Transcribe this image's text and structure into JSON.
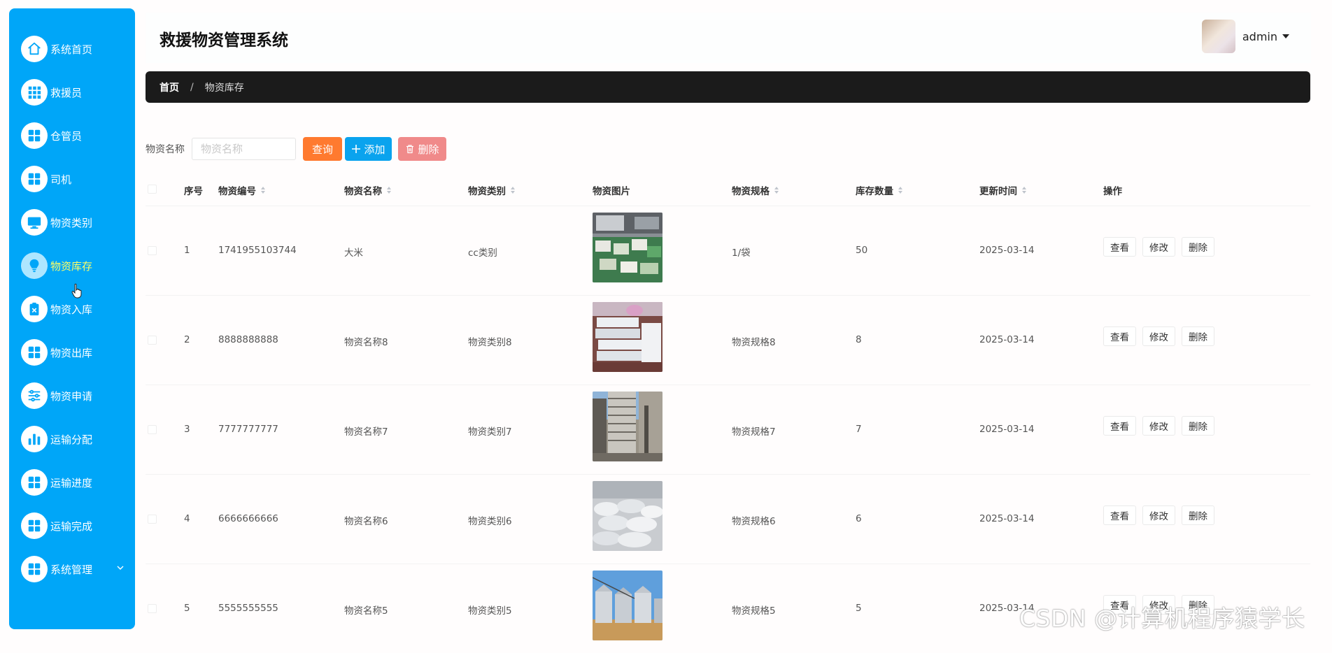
{
  "app": {
    "title": "救援物资管理系统"
  },
  "user": {
    "name": "admin"
  },
  "sidebar": {
    "items": [
      {
        "label": "系统首页",
        "icon": "home-icon"
      },
      {
        "label": "救援员",
        "icon": "grid-icon"
      },
      {
        "label": "仓管员",
        "icon": "grid-icon"
      },
      {
        "label": "司机",
        "icon": "grid-icon"
      },
      {
        "label": "物资类别",
        "icon": "monitor-icon"
      },
      {
        "label": "物资库存",
        "icon": "bulb-icon"
      },
      {
        "label": "物资入库",
        "icon": "clipboard-icon"
      },
      {
        "label": "物资出库",
        "icon": "grid-icon"
      },
      {
        "label": "物资申请",
        "icon": "sliders-icon"
      },
      {
        "label": "运输分配",
        "icon": "bar-chart-icon"
      },
      {
        "label": "运输进度",
        "icon": "grid-icon"
      },
      {
        "label": "运输完成",
        "icon": "grid-icon"
      },
      {
        "label": "系统管理",
        "icon": "grid-icon"
      }
    ],
    "active_index": 5,
    "colors": {
      "background": "#00a6f8",
      "active_text": "#ffff66"
    }
  },
  "breadcrumb": {
    "home": "首页",
    "separator": "/",
    "current": "物资库存"
  },
  "search": {
    "label": "物资名称",
    "placeholder": "物资名称",
    "value": "",
    "query_button": "查询",
    "add_button": "添加",
    "delete_button": "删除"
  },
  "table": {
    "headers": {
      "index": "序号",
      "code": "物资编号",
      "name": "物资名称",
      "category": "物资类别",
      "image": "物资图片",
      "spec": "物资规格",
      "stock": "库存数量",
      "updated": "更新时间",
      "actions": "操作"
    },
    "action_labels": {
      "view": "查看",
      "edit": "修改",
      "delete": "删除"
    },
    "rows": [
      {
        "index": "1",
        "code": "1741955103744",
        "name": "大米",
        "category": "cc类别",
        "spec": "1/袋",
        "stock": "50",
        "updated": "2025-03-14",
        "image": "rice-sacks-photo"
      },
      {
        "index": "2",
        "code": "8888888888",
        "name": "物资名称8",
        "category": "物资类别8",
        "spec": "物资规格8",
        "stock": "8",
        "updated": "2025-03-14",
        "image": "stacked-boxes-photo"
      },
      {
        "index": "3",
        "code": "7777777777",
        "name": "物资名称7",
        "category": "物资类别7",
        "spec": "物资规格7",
        "stock": "7",
        "updated": "2025-03-14",
        "image": "warehouse-racks-photo"
      },
      {
        "index": "4",
        "code": "6666666666",
        "name": "物资名称6",
        "category": "物资类别6",
        "spec": "物资规格6",
        "stock": "6",
        "updated": "2025-03-14",
        "image": "white-bags-photo"
      },
      {
        "index": "5",
        "code": "5555555555",
        "name": "物资名称5",
        "category": "物资类别5",
        "spec": "物资规格5",
        "stock": "5",
        "updated": "2025-03-14",
        "image": "grain-silos-photo"
      }
    ]
  },
  "watermark": "CSDN @计算机程序猿学长"
}
